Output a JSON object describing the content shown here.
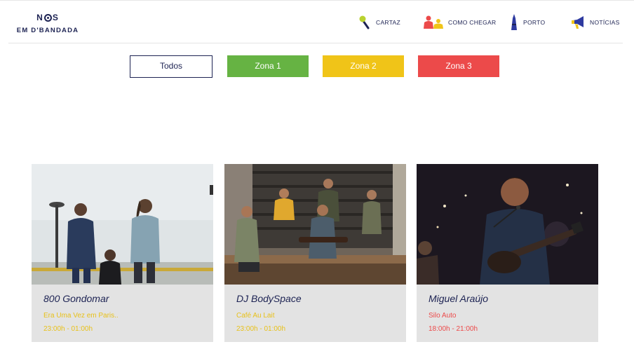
{
  "brand": {
    "line1_left": "N",
    "line1_right": "S",
    "line2": "EM D'BANDADA"
  },
  "nav": {
    "items": [
      {
        "label": "CARTAZ",
        "icon": "microphone-icon"
      },
      {
        "label": "COMO CHEGAR",
        "icon": "people-icon"
      },
      {
        "label": "PORTO",
        "icon": "tower-icon"
      },
      {
        "label": "NOTÍCIAS",
        "icon": "megaphone-icon"
      }
    ]
  },
  "filters": {
    "all": "Todos",
    "zone1": "Zona 1",
    "zone2": "Zona 2",
    "zone3": "Zona 3"
  },
  "colors": {
    "navy": "#1d2353",
    "zone1": "#66b343",
    "zone2": "#f0c418",
    "zone3": "#ec4a4a",
    "card_bg": "#e3e3e3"
  },
  "cards": [
    {
      "name": "800 Gondomar",
      "venue": "Era Uma Vez em Paris..",
      "time": "23:00h - 01:00h",
      "zone_color": "#e8c11a"
    },
    {
      "name": "DJ BodySpace",
      "venue": "Café Au Lait",
      "time": "23:00h - 01:00h",
      "zone_color": "#e8c11a"
    },
    {
      "name": "Miguel Araújo",
      "venue": "Silo Auto",
      "time": "18:00h - 21:00h",
      "zone_color": "#ec4a4a"
    }
  ]
}
